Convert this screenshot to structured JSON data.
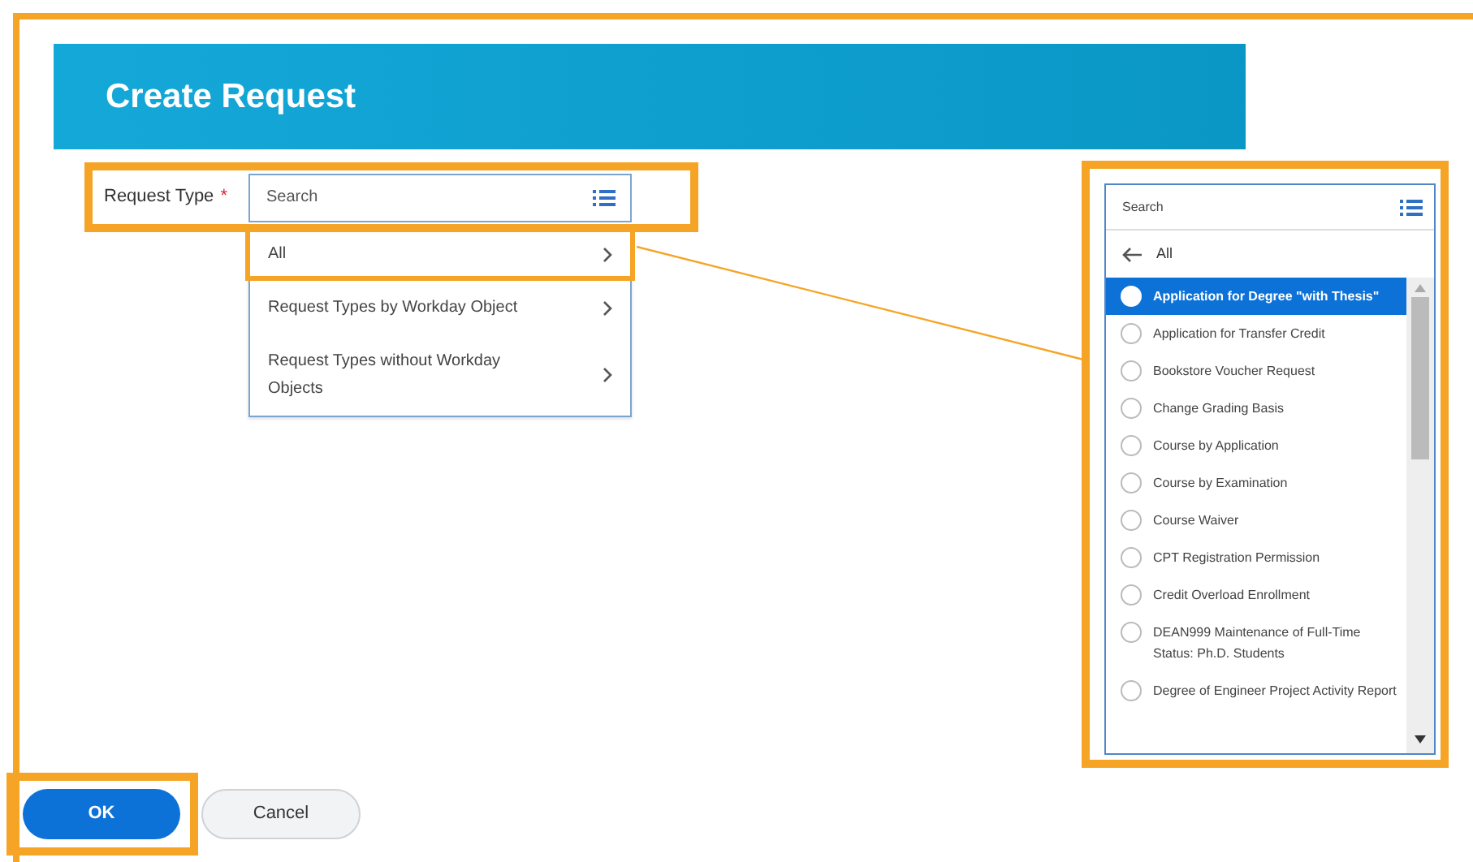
{
  "page_title": "Create Request",
  "request_type": {
    "label": "Request Type",
    "required_mark": "*",
    "placeholder": "Search",
    "highlighted": true
  },
  "category_options": [
    {
      "label": "All",
      "highlighted": true
    },
    {
      "label": "Request Types by Workday Object",
      "highlighted": false
    },
    {
      "label": "Request Types without Workday Objects",
      "highlighted": false
    }
  ],
  "side_panel": {
    "placeholder": "Search",
    "back_label": "All",
    "highlighted": true,
    "options": [
      {
        "label": "Application for Degree \"with Thesis\"",
        "selected": true
      },
      {
        "label": "Application for Transfer Credit",
        "selected": false
      },
      {
        "label": "Bookstore Voucher Request",
        "selected": false
      },
      {
        "label": "Change Grading Basis",
        "selected": false
      },
      {
        "label": "Course by Application",
        "selected": false
      },
      {
        "label": "Course by Examination",
        "selected": false
      },
      {
        "label": "Course Waiver",
        "selected": false
      },
      {
        "label": "CPT Registration Permission",
        "selected": false
      },
      {
        "label": "Credit Overload Enrollment",
        "selected": false
      },
      {
        "label": "DEAN999 Maintenance of Full-Time Status: Ph.D. Students",
        "selected": false
      },
      {
        "label": "Degree of Engineer Project Activity Report",
        "selected": false
      }
    ]
  },
  "buttons": [
    {
      "label": "OK",
      "kind": "primary",
      "highlighted": true
    },
    {
      "label": "Cancel",
      "kind": "secondary",
      "highlighted": false
    }
  ]
}
